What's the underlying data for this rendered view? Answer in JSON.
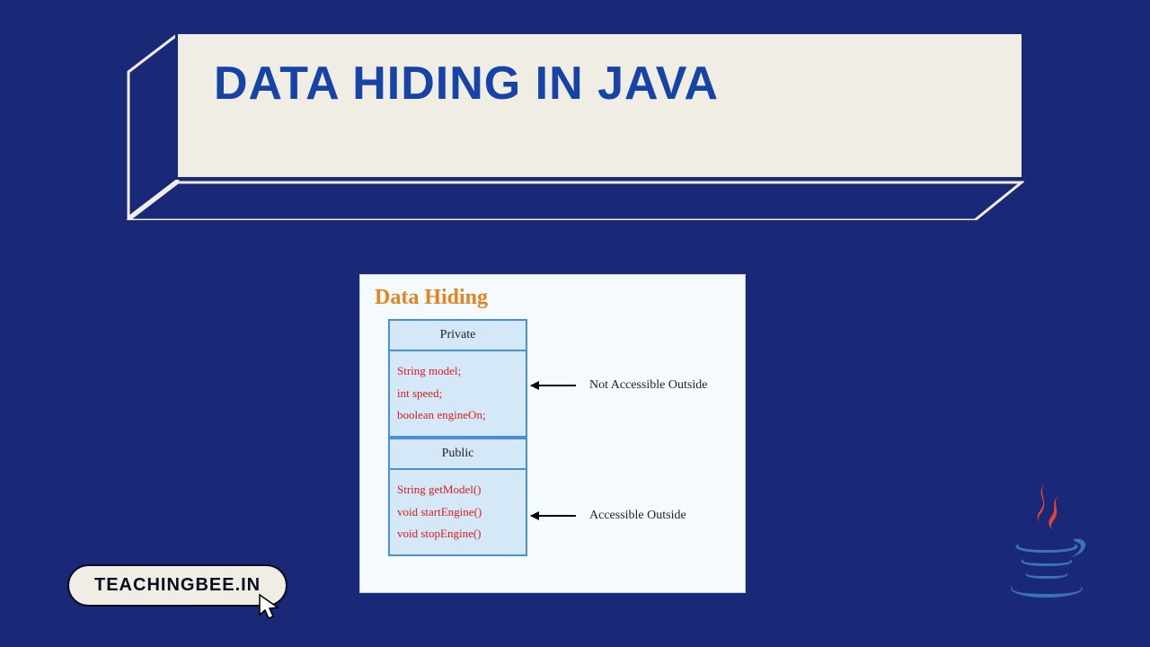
{
  "title": "DATA HIDING IN JAVA",
  "link": {
    "label": "TEACHINGBEE.IN"
  },
  "diagram": {
    "heading": "Data Hiding",
    "private": {
      "label": "Private",
      "members": [
        "String model;",
        "int speed;",
        "boolean engineOn;"
      ],
      "annotation": "Not Accessible Outside"
    },
    "public": {
      "label": "Public",
      "members": [
        "String getModel()",
        "void startEngine()",
        "void stopEngine()"
      ],
      "annotation": "Accessible Outside"
    }
  },
  "colors": {
    "background": "#1a2878",
    "title_text": "#1543a8",
    "box_fill": "#f0ede4",
    "diagram_header": "#e8831a",
    "code_text": "#d92020",
    "section_border": "#4a90d9"
  }
}
